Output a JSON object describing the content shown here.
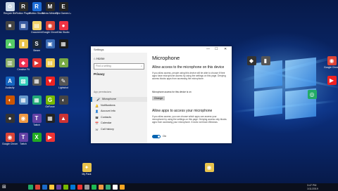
{
  "desktop": {
    "icons": [
      {
        "label": "Recycle Bin",
        "color": "#c9d7e6",
        "glyph": "♻"
      },
      {
        "label": "Roblox Player",
        "color": "#2b2b2b",
        "glyph": "R"
      },
      {
        "label": "Roblox Studio",
        "color": "#1d6cd6",
        "glyph": "R"
      },
      {
        "label": "Meow Minion Minion",
        "color": "#2a2a2a",
        "glyph": "M"
      },
      {
        "label": "Epic Games Launcher",
        "color": "#222",
        "glyph": "E"
      },
      {
        "label": "",
        "color": "#444",
        "glyph": "■"
      },
      {
        "label": "",
        "color": "#3a5ba0",
        "glyph": "▦"
      },
      {
        "label": "Document",
        "color": "#f2d36b",
        "glyph": "▤"
      },
      {
        "label": "Google Chrome",
        "color": "#db4437",
        "glyph": "◉"
      },
      {
        "label": "Disk Studio",
        "color": "#e34",
        "glyph": "●"
      },
      {
        "label": "",
        "color": "#5c6",
        "glyph": "▲"
      },
      {
        "label": "",
        "color": "#e9c34a",
        "glyph": "▮"
      },
      {
        "label": "Steam",
        "color": "#1b2838",
        "glyph": "S"
      },
      {
        "label": "",
        "color": "#3b6cb5",
        "glyph": "▣"
      },
      {
        "label": "",
        "color": "#1a1a1a",
        "glyph": "▦"
      },
      {
        "label": "",
        "color": "#8a6",
        "glyph": "▥"
      },
      {
        "label": "Creative Fit",
        "color": "#e35",
        "glyph": "◆"
      },
      {
        "label": "",
        "color": "#d33",
        "glyph": "▶"
      },
      {
        "label": "",
        "color": "#ecc94b",
        "glyph": "▤"
      },
      {
        "label": "",
        "color": "#7a4",
        "glyph": "▲"
      },
      {
        "label": "Audacity",
        "color": "#1565c0",
        "glyph": "A"
      },
      {
        "label": "",
        "color": "#3cb",
        "glyph": "▩"
      },
      {
        "label": "",
        "color": "#555",
        "glyph": "▦"
      },
      {
        "label": "",
        "color": "#e22",
        "glyph": "▼"
      },
      {
        "label": "Lightshot",
        "color": "#555",
        "glyph": "✎"
      },
      {
        "label": "",
        "color": "#c50",
        "glyph": "◐"
      },
      {
        "label": "",
        "color": "#69c",
        "glyph": "▦"
      },
      {
        "label": "",
        "color": "#2a7",
        "glyph": "▦"
      },
      {
        "label": "GeForce",
        "color": "#76b900",
        "glyph": "G"
      },
      {
        "label": "",
        "color": "#444",
        "glyph": "◐"
      },
      {
        "label": "",
        "color": "#333",
        "glyph": "●"
      },
      {
        "label": "",
        "color": "#e94",
        "glyph": "◉"
      },
      {
        "label": "Twitch",
        "color": "#6441a5",
        "glyph": "T"
      },
      {
        "label": "",
        "color": "#222",
        "glyph": "▦"
      },
      {
        "label": "",
        "color": "#c33",
        "glyph": "▲"
      },
      {
        "label": "Google Chrome",
        "color": "#db4437",
        "glyph": "◉"
      },
      {
        "label": "Twitch",
        "color": "#6441a5",
        "glyph": "T"
      },
      {
        "label": "",
        "color": "#2a2",
        "glyph": "X"
      },
      {
        "label": "",
        "color": "#e33",
        "glyph": "▶"
      }
    ],
    "right_icons": [
      {
        "label": "",
        "color": "#333",
        "glyph": "◆"
      },
      {
        "label": "",
        "color": "#555",
        "glyph": "▮"
      },
      {
        "label": "Google Chrome",
        "color": "#db4437",
        "glyph": "◉"
      },
      {
        "label": "",
        "color": "#e22",
        "glyph": "▶"
      },
      {
        "label": "",
        "color": "#2a6",
        "glyph": "◎"
      },
      {
        "label": "My Pack",
        "color": "#e8c34b",
        "glyph": "✦"
      },
      {
        "label": "",
        "color": "#e8c34b",
        "glyph": "◉"
      }
    ]
  },
  "window": {
    "title": "Settings",
    "controls": [
      "—",
      "☐",
      "✕"
    ],
    "home": "Home",
    "search_placeholder": "Find a setting",
    "category": "Privacy",
    "section_label": "App permissions",
    "nav": [
      {
        "icon": "🎤",
        "label": "Microphone",
        "selected": true
      },
      {
        "icon": "🔔",
        "label": "Notifications",
        "selected": false
      },
      {
        "icon": "👤",
        "label": "Account info",
        "selected": false
      },
      {
        "icon": "☎",
        "label": "Contacts",
        "selected": false
      },
      {
        "icon": "📅",
        "label": "Calendar",
        "selected": false
      },
      {
        "icon": "☏",
        "label": "Call history",
        "selected": false
      }
    ],
    "page_title": "Microphone",
    "heading1": "Allow access to the microphone on this device",
    "para1": "If you allow access, people using this device will be able to choose if their apps have microphone access by using the settings on this page. Denying access blocks apps from accessing the microphone.",
    "status": "Microphone access for this device is on",
    "change_button": "Change",
    "heading2": "Allow apps to access your microphone",
    "para2": "If you allow access, you can choose which apps can access your microphone by using the settings on this page. Denying access only blocks apps from accessing your microphone. It does not block Windows.",
    "toggle_label": "On"
  },
  "taskbar": {
    "start": "⊞",
    "apps": [
      "#2a6",
      "#db4437",
      "#1b6ac9",
      "#ffc83d",
      "#6441a5",
      "#76b900",
      "#0078d7",
      "#e33",
      "#999",
      "#1db954",
      "#e94",
      "#3a7",
      "#fff",
      "#f5a623"
    ],
    "time": "3:47 PM",
    "date": "1/11/2019"
  }
}
